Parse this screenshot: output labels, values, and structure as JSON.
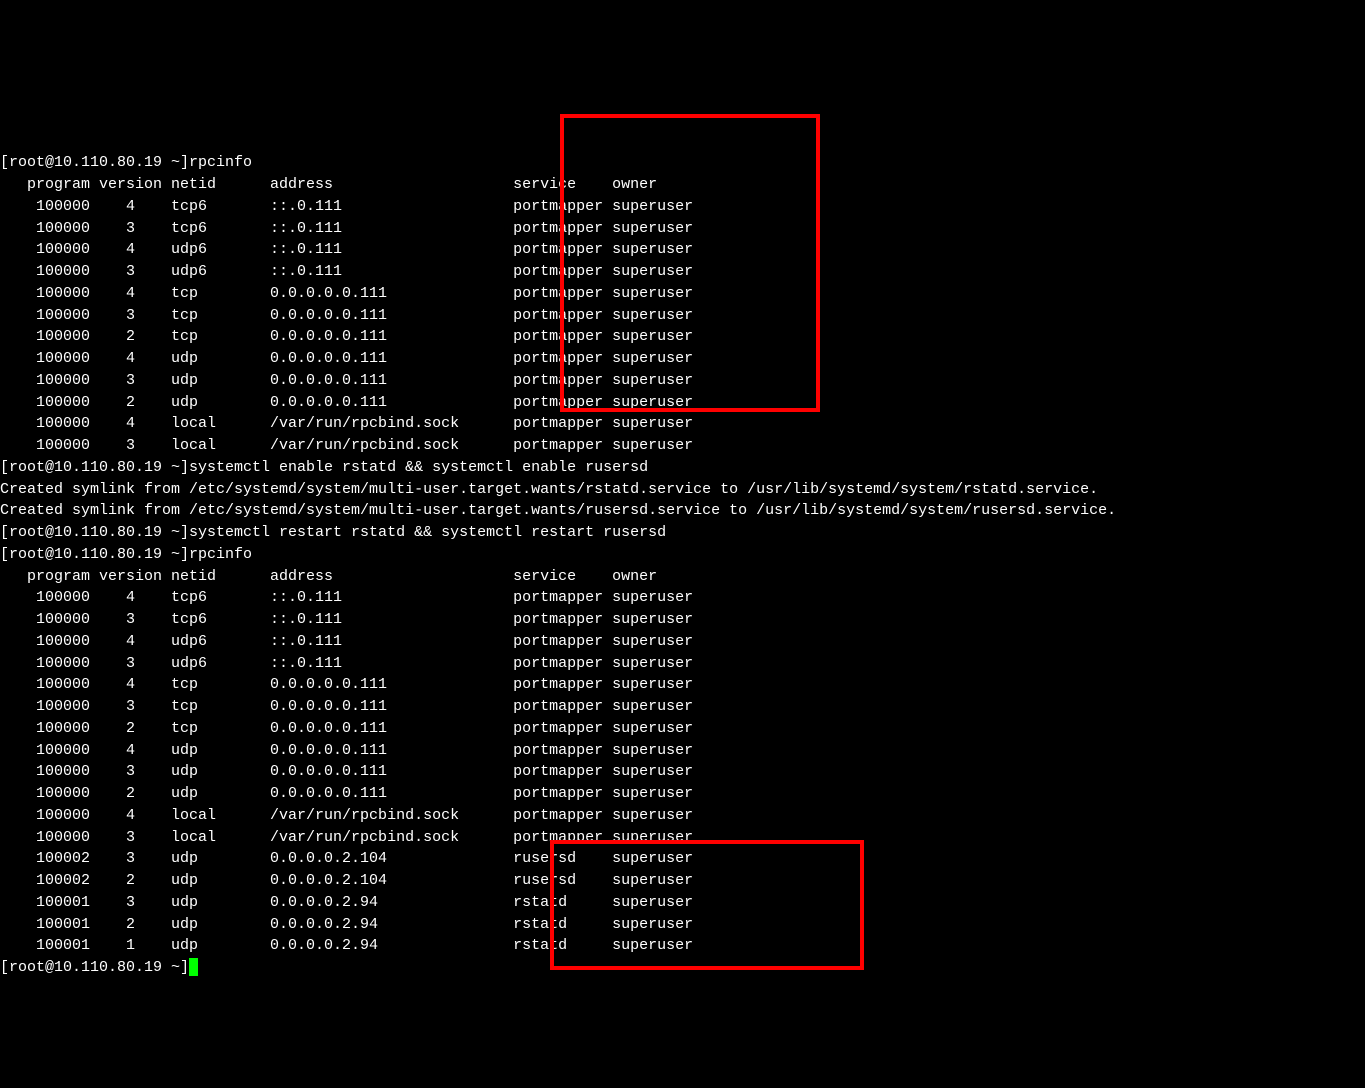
{
  "prompts": {
    "prompt1": "[root@10.110.80.19 ~]",
    "cmd1": "rpcinfo",
    "prompt2": "[root@10.110.80.19 ~]",
    "cmd2": "systemctl enable rstatd && systemctl enable rusersd",
    "enable_output1": "Created symlink from /etc/systemd/system/multi-user.target.wants/rstatd.service to /usr/lib/systemd/system/rstatd.service.",
    "enable_output2": "Created symlink from /etc/systemd/system/multi-user.target.wants/rusersd.service to /usr/lib/systemd/system/rusersd.service.",
    "prompt3": "[root@10.110.80.19 ~]",
    "cmd3": "systemctl restart rstatd && systemctl restart rusersd",
    "prompt4": "[root@10.110.80.19 ~]",
    "cmd4": "rpcinfo",
    "prompt5": "[root@10.110.80.19 ~]"
  },
  "header": {
    "program": "program",
    "version": "version",
    "netid": "netid",
    "address": "address",
    "service": "service",
    "owner": "owner"
  },
  "rpcinfo1": [
    {
      "program": "100000",
      "version": "4",
      "netid": "tcp6",
      "address": "::.0.111",
      "service": "portmapper",
      "owner": "superuser"
    },
    {
      "program": "100000",
      "version": "3",
      "netid": "tcp6",
      "address": "::.0.111",
      "service": "portmapper",
      "owner": "superuser"
    },
    {
      "program": "100000",
      "version": "4",
      "netid": "udp6",
      "address": "::.0.111",
      "service": "portmapper",
      "owner": "superuser"
    },
    {
      "program": "100000",
      "version": "3",
      "netid": "udp6",
      "address": "::.0.111",
      "service": "portmapper",
      "owner": "superuser"
    },
    {
      "program": "100000",
      "version": "4",
      "netid": "tcp",
      "address": "0.0.0.0.0.111",
      "service": "portmapper",
      "owner": "superuser"
    },
    {
      "program": "100000",
      "version": "3",
      "netid": "tcp",
      "address": "0.0.0.0.0.111",
      "service": "portmapper",
      "owner": "superuser"
    },
    {
      "program": "100000",
      "version": "2",
      "netid": "tcp",
      "address": "0.0.0.0.0.111",
      "service": "portmapper",
      "owner": "superuser"
    },
    {
      "program": "100000",
      "version": "4",
      "netid": "udp",
      "address": "0.0.0.0.0.111",
      "service": "portmapper",
      "owner": "superuser"
    },
    {
      "program": "100000",
      "version": "3",
      "netid": "udp",
      "address": "0.0.0.0.0.111",
      "service": "portmapper",
      "owner": "superuser"
    },
    {
      "program": "100000",
      "version": "2",
      "netid": "udp",
      "address": "0.0.0.0.0.111",
      "service": "portmapper",
      "owner": "superuser"
    },
    {
      "program": "100000",
      "version": "4",
      "netid": "local",
      "address": "/var/run/rpcbind.sock",
      "service": "portmapper",
      "owner": "superuser"
    },
    {
      "program": "100000",
      "version": "3",
      "netid": "local",
      "address": "/var/run/rpcbind.sock",
      "service": "portmapper",
      "owner": "superuser"
    }
  ],
  "rpcinfo2": [
    {
      "program": "100000",
      "version": "4",
      "netid": "tcp6",
      "address": "::.0.111",
      "service": "portmapper",
      "owner": "superuser"
    },
    {
      "program": "100000",
      "version": "3",
      "netid": "tcp6",
      "address": "::.0.111",
      "service": "portmapper",
      "owner": "superuser"
    },
    {
      "program": "100000",
      "version": "4",
      "netid": "udp6",
      "address": "::.0.111",
      "service": "portmapper",
      "owner": "superuser"
    },
    {
      "program": "100000",
      "version": "3",
      "netid": "udp6",
      "address": "::.0.111",
      "service": "portmapper",
      "owner": "superuser"
    },
    {
      "program": "100000",
      "version": "4",
      "netid": "tcp",
      "address": "0.0.0.0.0.111",
      "service": "portmapper",
      "owner": "superuser"
    },
    {
      "program": "100000",
      "version": "3",
      "netid": "tcp",
      "address": "0.0.0.0.0.111",
      "service": "portmapper",
      "owner": "superuser"
    },
    {
      "program": "100000",
      "version": "2",
      "netid": "tcp",
      "address": "0.0.0.0.0.111",
      "service": "portmapper",
      "owner": "superuser"
    },
    {
      "program": "100000",
      "version": "4",
      "netid": "udp",
      "address": "0.0.0.0.0.111",
      "service": "portmapper",
      "owner": "superuser"
    },
    {
      "program": "100000",
      "version": "3",
      "netid": "udp",
      "address": "0.0.0.0.0.111",
      "service": "portmapper",
      "owner": "superuser"
    },
    {
      "program": "100000",
      "version": "2",
      "netid": "udp",
      "address": "0.0.0.0.0.111",
      "service": "portmapper",
      "owner": "superuser"
    },
    {
      "program": "100000",
      "version": "4",
      "netid": "local",
      "address": "/var/run/rpcbind.sock",
      "service": "portmapper",
      "owner": "superuser"
    },
    {
      "program": "100000",
      "version": "3",
      "netid": "local",
      "address": "/var/run/rpcbind.sock",
      "service": "portmapper",
      "owner": "superuser"
    },
    {
      "program": "100002",
      "version": "3",
      "netid": "udp",
      "address": "0.0.0.0.2.104",
      "service": "rusersd",
      "owner": "superuser"
    },
    {
      "program": "100002",
      "version": "2",
      "netid": "udp",
      "address": "0.0.0.0.2.104",
      "service": "rusersd",
      "owner": "superuser"
    },
    {
      "program": "100001",
      "version": "3",
      "netid": "udp",
      "address": "0.0.0.0.2.94",
      "service": "rstatd",
      "owner": "superuser"
    },
    {
      "program": "100001",
      "version": "2",
      "netid": "udp",
      "address": "0.0.0.0.2.94",
      "service": "rstatd",
      "owner": "superuser"
    },
    {
      "program": "100001",
      "version": "1",
      "netid": "udp",
      "address": "0.0.0.0.2.94",
      "service": "rstatd",
      "owner": "superuser"
    }
  ]
}
